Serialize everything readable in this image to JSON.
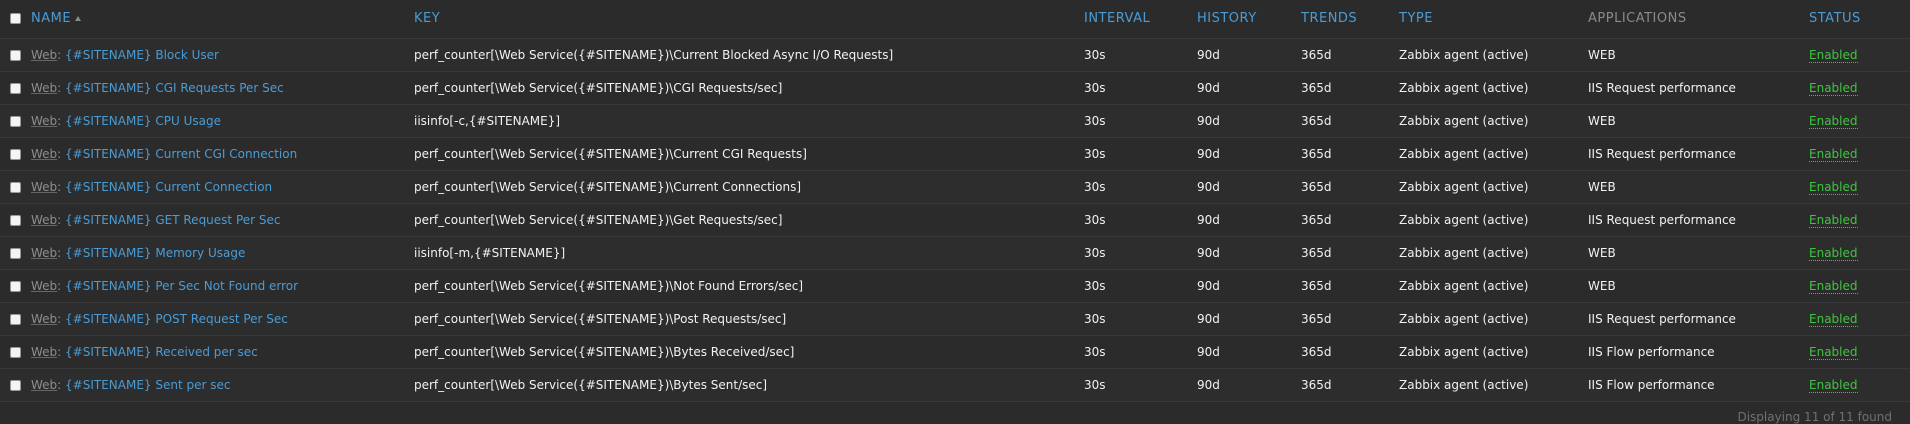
{
  "headers": {
    "name": "NAME",
    "key": "KEY",
    "interval": "INTERVAL",
    "history": "HISTORY",
    "trends": "TRENDS",
    "type": "TYPE",
    "applications": "APPLICATIONS",
    "status": "STATUS"
  },
  "sort": {
    "column": "name",
    "direction": "asc",
    "icon": "sort-ascending-icon"
  },
  "rows": [
    {
      "prefix": "Web",
      "name": "{#SITENAME} Block User",
      "key": "perf_counter[\\Web Service({#SITENAME})\\Current Blocked Async I/O Requests]",
      "interval": "30s",
      "history": "90d",
      "trends": "365d",
      "type": "Zabbix agent (active)",
      "application": "WEB",
      "status": "Enabled"
    },
    {
      "prefix": "Web",
      "name": "{#SITENAME} CGI Requests Per Sec",
      "key": "perf_counter[\\Web Service({#SITENAME})\\CGI Requests/sec]",
      "interval": "30s",
      "history": "90d",
      "trends": "365d",
      "type": "Zabbix agent (active)",
      "application": "IIS Request performance",
      "status": "Enabled"
    },
    {
      "prefix": "Web",
      "name": "{#SITENAME} CPU Usage",
      "key": "iisinfo[-c,{#SITENAME}]",
      "interval": "30s",
      "history": "90d",
      "trends": "365d",
      "type": "Zabbix agent (active)",
      "application": "WEB",
      "status": "Enabled"
    },
    {
      "prefix": "Web",
      "name": "{#SITENAME} Current CGI Connection",
      "key": "perf_counter[\\Web Service({#SITENAME})\\Current CGI Requests]",
      "interval": "30s",
      "history": "90d",
      "trends": "365d",
      "type": "Zabbix agent (active)",
      "application": "IIS Request performance",
      "status": "Enabled"
    },
    {
      "prefix": "Web",
      "name": "{#SITENAME} Current Connection",
      "key": "perf_counter[\\Web Service({#SITENAME})\\Current Connections]",
      "interval": "30s",
      "history": "90d",
      "trends": "365d",
      "type": "Zabbix agent (active)",
      "application": "WEB",
      "status": "Enabled"
    },
    {
      "prefix": "Web",
      "name": "{#SITENAME} GET Request Per Sec",
      "key": "perf_counter[\\Web Service({#SITENAME})\\Get Requests/sec]",
      "interval": "30s",
      "history": "90d",
      "trends": "365d",
      "type": "Zabbix agent (active)",
      "application": "IIS Request performance",
      "status": "Enabled"
    },
    {
      "prefix": "Web",
      "name": "{#SITENAME} Memory Usage",
      "key": "iisinfo[-m,{#SITENAME}]",
      "interval": "30s",
      "history": "90d",
      "trends": "365d",
      "type": "Zabbix agent (active)",
      "application": "WEB",
      "status": "Enabled"
    },
    {
      "prefix": "Web",
      "name": "{#SITENAME} Per Sec Not Found error",
      "key": "perf_counter[\\Web Service({#SITENAME})\\Not Found Errors/sec]",
      "interval": "30s",
      "history": "90d",
      "trends": "365d",
      "type": "Zabbix agent (active)",
      "application": "WEB",
      "status": "Enabled"
    },
    {
      "prefix": "Web",
      "name": "{#SITENAME} POST Request Per Sec",
      "key": "perf_counter[\\Web Service({#SITENAME})\\Post Requests/sec]",
      "interval": "30s",
      "history": "90d",
      "trends": "365d",
      "type": "Zabbix agent (active)",
      "application": "IIS Request performance",
      "status": "Enabled"
    },
    {
      "prefix": "Web",
      "name": "{#SITENAME} Received per sec",
      "key": "perf_counter[\\Web Service({#SITENAME})\\Bytes Received/sec]",
      "interval": "30s",
      "history": "90d",
      "trends": "365d",
      "type": "Zabbix agent (active)",
      "application": "IIS Flow performance",
      "status": "Enabled"
    },
    {
      "prefix": "Web",
      "name": "{#SITENAME} Sent per sec",
      "key": "perf_counter[\\Web Service({#SITENAME})\\Bytes Sent/sec]",
      "interval": "30s",
      "history": "90d",
      "trends": "365d",
      "type": "Zabbix agent (active)",
      "application": "IIS Flow performance",
      "status": "Enabled"
    }
  ],
  "footer": {
    "text": "Displaying 11 of 11 found"
  },
  "colors": {
    "background": "#2b2b2b",
    "header_link": "#4a9cd6",
    "header_muted": "#8a8a8a",
    "status_enabled": "#3fc53f",
    "text": "#f2f2f2"
  }
}
